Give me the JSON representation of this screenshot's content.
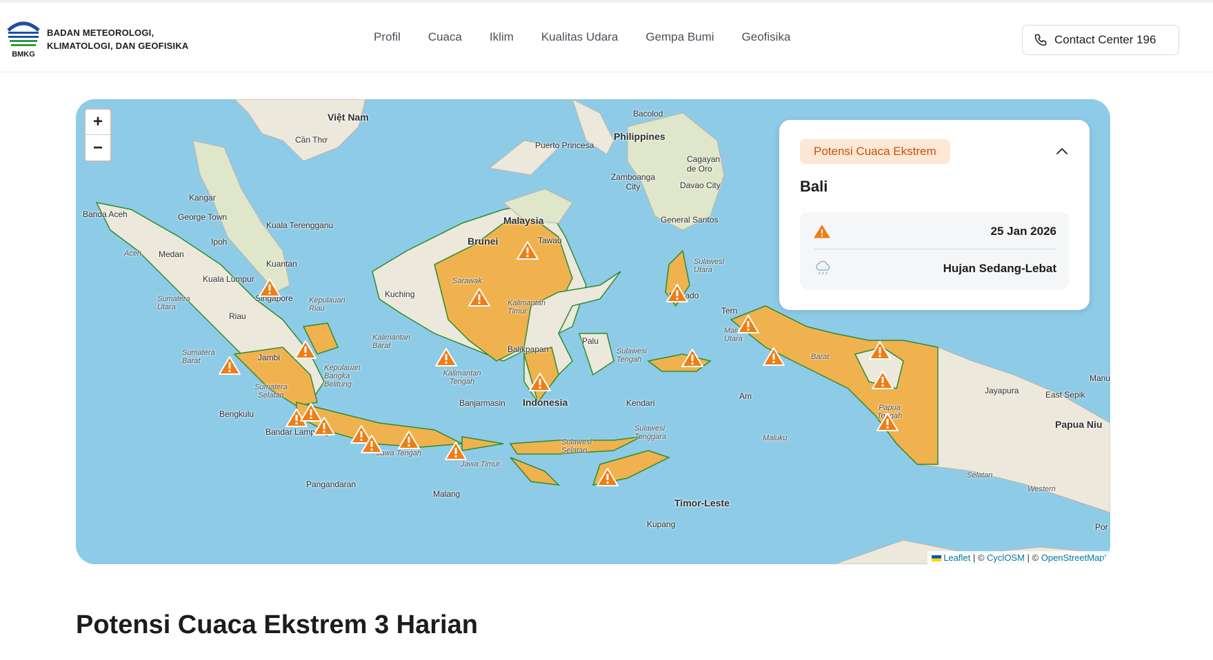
{
  "header": {
    "org_line1": "BADAN METEOROLOGI,",
    "org_line2": "KLIMATOLOGI, DAN GEOFISIKA",
    "logo_text": "BMKG",
    "nav": [
      "Profil",
      "Cuaca",
      "Iklim",
      "Kualitas Udara",
      "Gempa Bumi",
      "Geofisika"
    ],
    "contact_label": "Contact Center 196"
  },
  "map": {
    "zoom_in": "+",
    "zoom_out": "−",
    "labels": {
      "vietnam": "Việt Nam",
      "cantho": "Cần Thơ",
      "bacolod": "Bacolod",
      "philippines": "Philippines",
      "puertoprincesa": "Puerto Princesa",
      "cagayan": "Cagayan de Oro",
      "zamboanga": "Zamboanga City",
      "davao": "Davao City",
      "generalsantos": "General Santos",
      "kangar": "Kangar",
      "georgetown": "George Town",
      "kualaterengganu": "Kuala Terengganu",
      "bandaaceh": "Banda Aceh",
      "ipoh": "Ipoh",
      "kuantan": "Kuantan",
      "kualalumpur": "Kuala Lumpur",
      "singapore": "Singapore",
      "malaysia": "Malaysia",
      "brunei": "Brunei",
      "tawau": "Tawau",
      "kuching": "Kuching",
      "medan": "Medan",
      "riau": "Riau",
      "jambi": "Jambi",
      "bengkulu": "Bengkulu",
      "bandarlampung": "Bandar Lampung",
      "pangandaran": "Pangandaran",
      "malang": "Malang",
      "banjarmasin": "Banjarmasin",
      "balikpapan": "Balikpapan",
      "indonesia": "Indonesia",
      "palu": "Palu",
      "kendari": "Kendari",
      "manado": "Manado",
      "timorleste": "Timor-Leste",
      "kupang": "Kupang",
      "jayapura": "Jayapura",
      "papuaniu": "Papua Niu",
      "eastsepik": "East Sepik",
      "western": "Western",
      "manu": "Manu",
      "por": "Por",
      "aceh": "Aceh",
      "sarawak": "Sarawak",
      "kaltara": "Kalimantan Timur",
      "kalbar": "Kalimantan Barat",
      "kalteng": "Kalimantan Tengah",
      "sumut": "Sumatera Utara",
      "sumbar": "Sumatera Barat",
      "sumsel": "Sumatera Selatan",
      "kepriau": "Kepulauan Riau",
      "kepbangka": "Kepulauan Bangka Belitung",
      "jateng": "Jawa Tengah",
      "jatim": "Jawa Timur",
      "sulsel": "Sulawesi Selatan",
      "sulteng": "Sulawesi Tengah",
      "sultra": "Sulawesi Tenggara",
      "sulut": "Sulawesi Utara",
      "maluku": "Maluku",
      "malukuutara": "Maluku Utara",
      "ternate": "Tern",
      "ambon": "Am",
      "papuatengah": "Papua Tengah",
      "papuaselatan": "Selatan",
      "barat": "Barat"
    },
    "attribution": {
      "leaflet": "Leaflet",
      "sep1": " | © ",
      "cyclosm": "CyclOSM",
      "sep2": " | © ",
      "osm": "OpenStreetMap'"
    },
    "warning_count": 22
  },
  "popup": {
    "badge": "Potensi Cuaca Ekstrem",
    "region": "Bali",
    "date": "25 Jan 2026",
    "weather": "Hujan Sedang-Lebat"
  },
  "section_title": "Potensi Cuaca Ekstrem 3 Harian",
  "colors": {
    "sea": "#8ecbe6",
    "land": "#ece8dc",
    "warning_area": "#efb24e",
    "warning_icon": "#f07d14",
    "badge_bg": "#fde8d6",
    "badge_text": "#c8510a"
  }
}
